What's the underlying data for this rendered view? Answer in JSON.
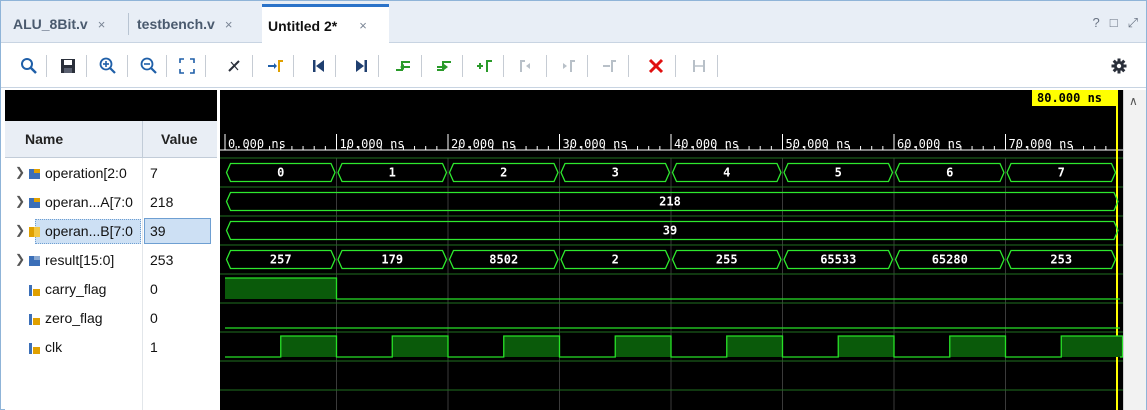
{
  "tabs": [
    {
      "label": "ALU_8Bit.v",
      "active": false
    },
    {
      "label": "testbench.v",
      "active": false
    },
    {
      "label": "Untitled 2*",
      "active": true
    }
  ],
  "tab_close_glyph": "×",
  "window_controls": [
    "?",
    "□",
    "⤢"
  ],
  "toolbar_icons": [
    "search-icon",
    "save-icon",
    "zoom-in-icon",
    "zoom-out-icon",
    "zoom-fit-icon",
    "cursor-icon",
    "go-to-cursor-icon",
    "go-to-start-icon",
    "go-to-end-icon",
    "previous-transition-icon",
    "next-transition-icon",
    "add-marker-icon",
    "previous-marker-icon",
    "next-marker-icon",
    "swap-cursors-icon",
    "delete-icon",
    "snap-icon",
    "settings-icon"
  ],
  "columns": {
    "name": "Name",
    "value": "Value"
  },
  "signals": [
    {
      "name": "operation[2:0]",
      "display_name": "operation[2:0",
      "value": "7",
      "kind": "bus",
      "expandable": true,
      "selected": false
    },
    {
      "name": "operandA[7:0]",
      "display_name": "operan...A[7:0",
      "value": "218",
      "kind": "bus",
      "expandable": true,
      "selected": false
    },
    {
      "name": "operandB[7:0]",
      "display_name": "operan...B[7:0",
      "value": "39",
      "kind": "bus",
      "expandable": true,
      "selected": true
    },
    {
      "name": "result[15:0]",
      "display_name": "result[15:0]",
      "value": "253",
      "kind": "bus",
      "expandable": true,
      "selected": false
    },
    {
      "name": "carry_flag",
      "display_name": "carry_flag",
      "value": "0",
      "kind": "bit",
      "expandable": false,
      "selected": false
    },
    {
      "name": "zero_flag",
      "display_name": "zero_flag",
      "value": "0",
      "kind": "bit",
      "expandable": false,
      "selected": false
    },
    {
      "name": "clk",
      "display_name": "clk",
      "value": "1",
      "kind": "bit",
      "expandable": false,
      "selected": false
    }
  ],
  "timeline": {
    "cursor_label": "80.000 ns",
    "ticks": [
      "0.000 ns",
      "10.000 ns",
      "20.000 ns",
      "30.000 ns",
      "40.000 ns",
      "50.000 ns",
      "60.000 ns",
      "70.000 ns"
    ],
    "segment_ns": 10,
    "operation_values": [
      "0",
      "1",
      "2",
      "3",
      "4",
      "5",
      "6",
      "7"
    ],
    "operandA_value": "218",
    "operandB_value": "39",
    "result_values": [
      "257",
      "179",
      "8502",
      "2",
      "255",
      "65533",
      "65280",
      "253"
    ],
    "carry_flag_high_until_ns": 10,
    "zero_flag_high": false,
    "clk_period_ns": 10,
    "clk_high_from_ns_in_period": 5
  },
  "colors": {
    "wave_bg": "#000000",
    "signal_green": "#27e027",
    "bus_outline": "#2ee82e",
    "fill_green": "#0a5a0a",
    "cursor_yellow": "#ffff00",
    "tab_active_accent": "#2b73c9",
    "delete_red": "#e01010"
  }
}
